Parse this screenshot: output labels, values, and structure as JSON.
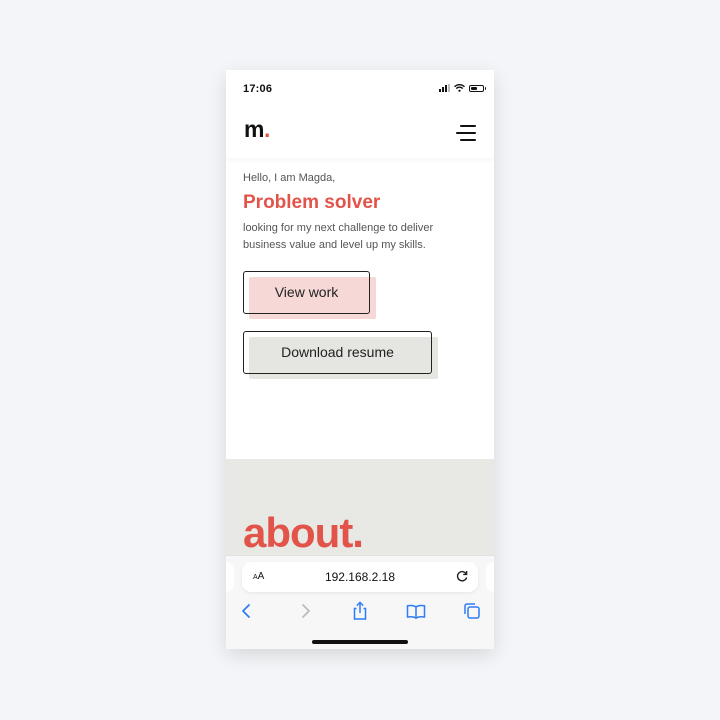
{
  "status_bar": {
    "time": "17:06"
  },
  "header": {
    "logo_text": "m",
    "logo_dot": "."
  },
  "hero": {
    "greeting": "Hello, I am Magda,",
    "headline": "Problem solver",
    "tagline": "looking for my next challenge to deliver business value and level up my skills.",
    "primary_button": "View work",
    "secondary_button": "Download resume"
  },
  "about": {
    "title": "about."
  },
  "browser": {
    "text_size_label": "AA",
    "url": "192.168.2.18"
  },
  "colors": {
    "accent": "#e2544a",
    "primary_button_bg": "#f6d8d6",
    "secondary_button_bg": "#e5e5e2",
    "about_bg": "#e8e8e5",
    "ios_blue": "#2f7cf6"
  },
  "icons": [
    "signal-icon",
    "wifi-icon",
    "battery-icon",
    "menu-icon",
    "reload-icon",
    "back-icon",
    "forward-icon",
    "share-icon",
    "bookmarks-icon",
    "tabs-icon"
  ]
}
